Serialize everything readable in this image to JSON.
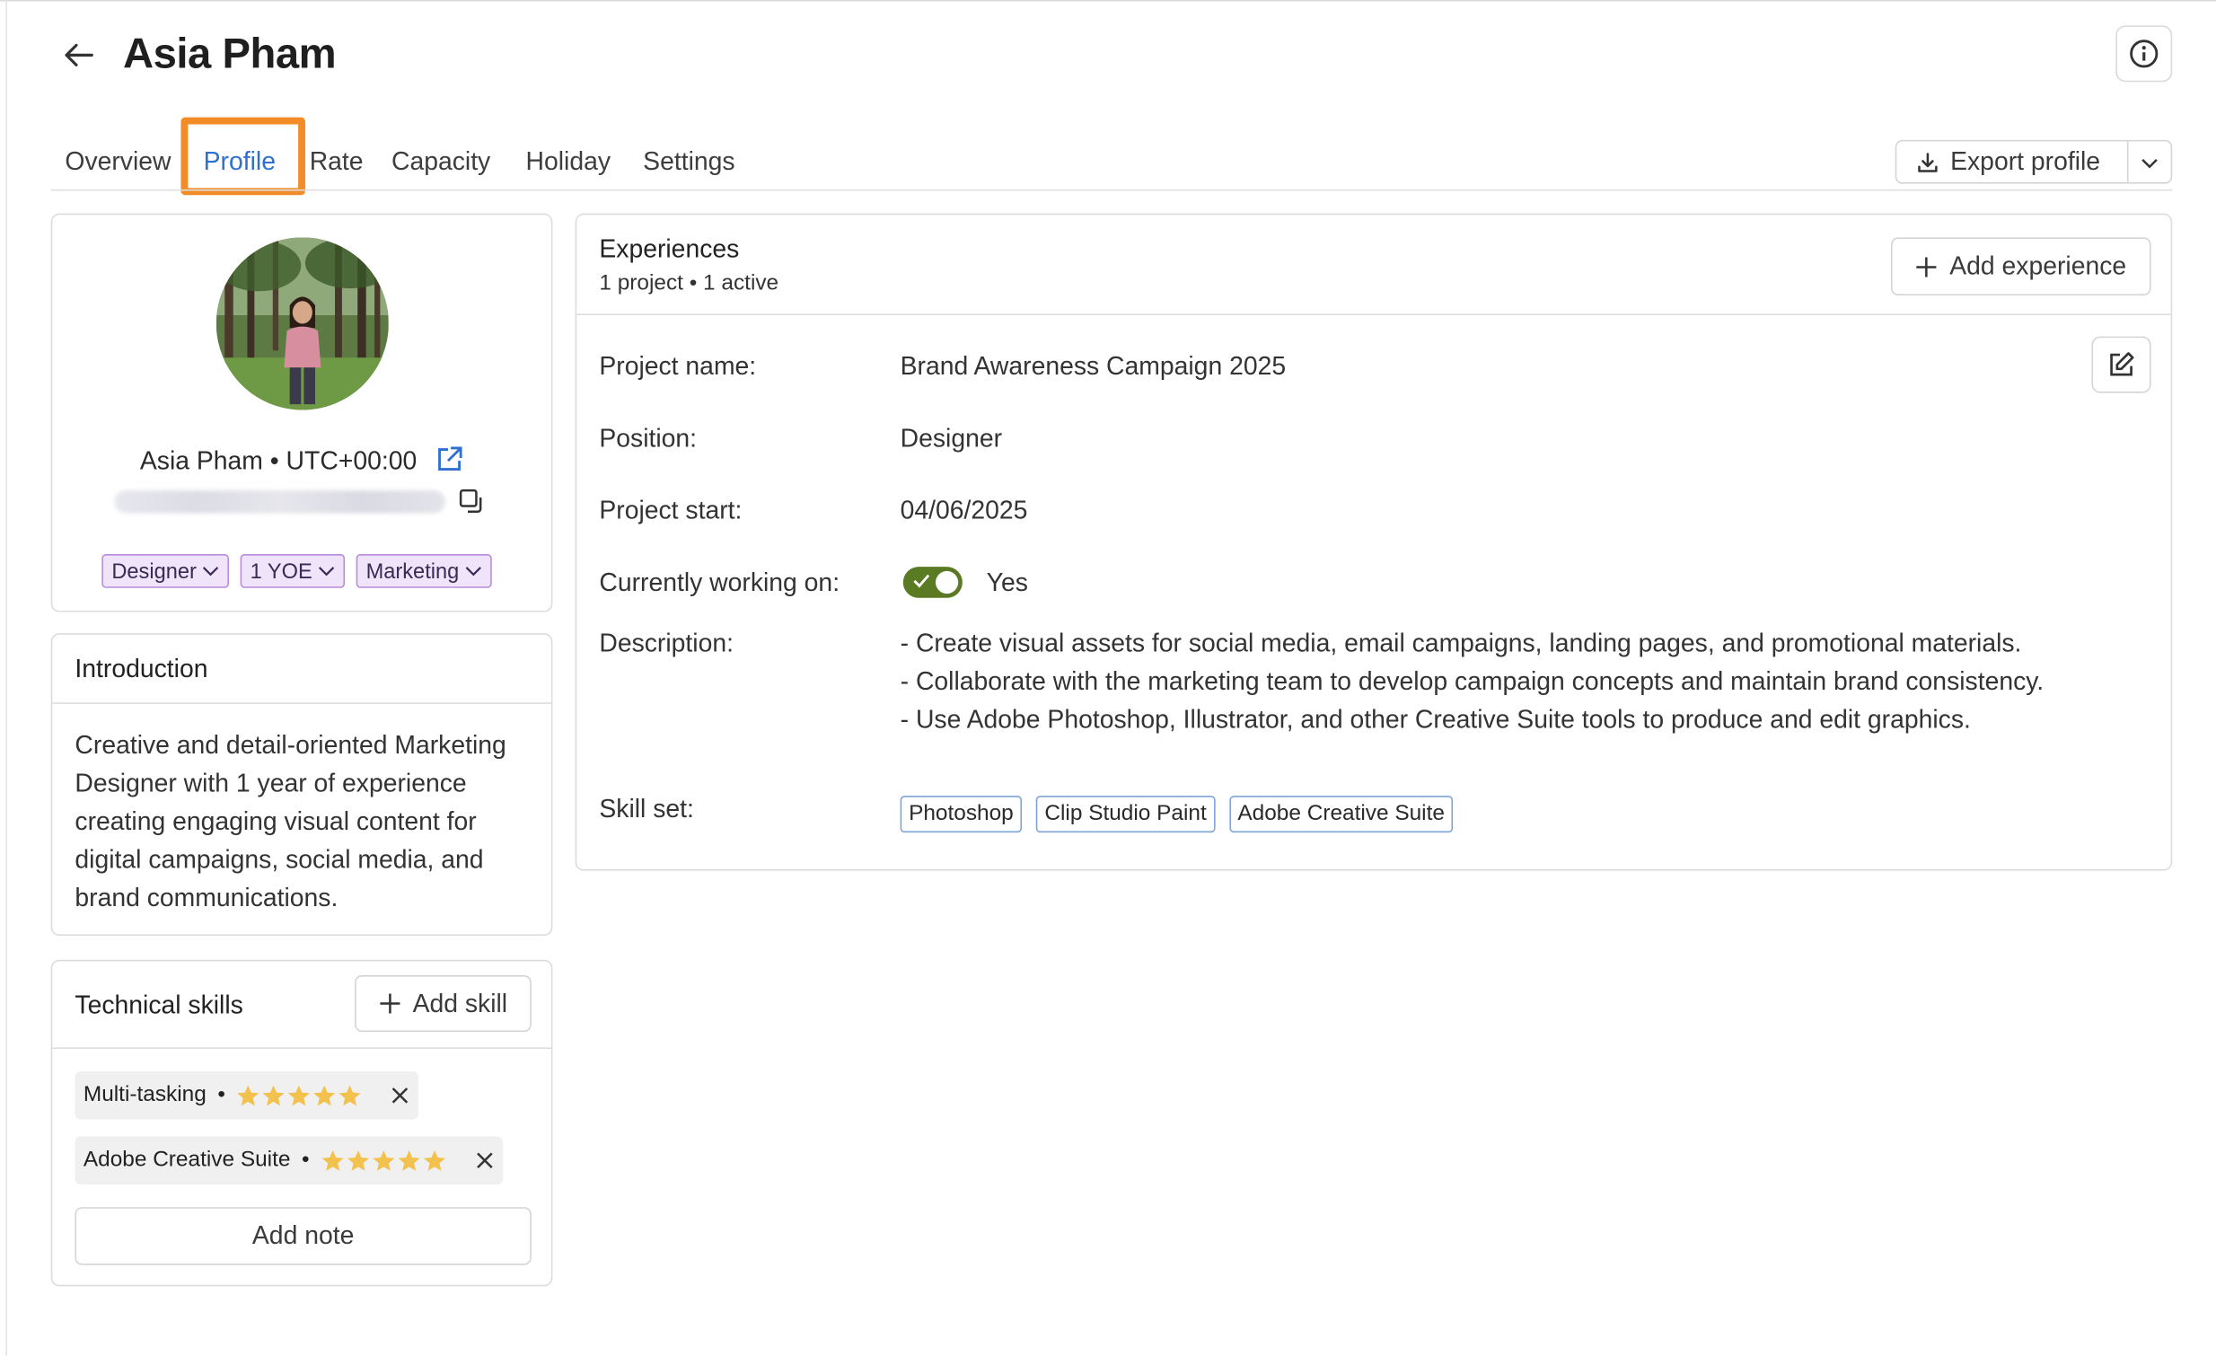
{
  "header": {
    "title": "Asia Pham"
  },
  "tabs": [
    {
      "label": "Overview"
    },
    {
      "label": "Profile"
    },
    {
      "label": "Rate"
    },
    {
      "label": "Capacity"
    },
    {
      "label": "Holiday"
    },
    {
      "label": "Settings"
    }
  ],
  "active_tab": "Profile",
  "export": {
    "label": "Export profile"
  },
  "profile": {
    "name_line": "Asia Pham • UTC+00:00",
    "pills": [
      {
        "label": "Designer"
      },
      {
        "label": "1 YOE"
      },
      {
        "label": "Marketing"
      }
    ]
  },
  "introduction": {
    "title": "Introduction",
    "text": "Creative and detail-oriented Marketing Designer with 1 year of experience creating engaging visual content for digital campaigns, social media, and brand communications."
  },
  "skills": {
    "title": "Technical skills",
    "add_label": "Add skill",
    "items": [
      {
        "name": "Multi-tasking",
        "rating": 5
      },
      {
        "name": "Adobe Creative Suite",
        "rating": 5
      }
    ],
    "add_note_label": "Add note"
  },
  "experiences": {
    "title": "Experiences",
    "subtitle": "1 project • 1 active",
    "add_label": "Add experience",
    "labels": {
      "project_name": "Project name:",
      "position": "Position:",
      "project_start": "Project start:",
      "currently_working": "Currently working on:",
      "description": "Description:",
      "skill_set": "Skill set:"
    },
    "values": {
      "project_name": "Brand Awareness Campaign 2025",
      "position": "Designer",
      "project_start": "04/06/2025",
      "currently_working": "Yes",
      "description": [
        "- Create visual assets for social media, email campaigns, landing pages, and promotional materials.",
        "- Collaborate with the marketing team to develop campaign concepts and maintain brand consistency.",
        "- Use Adobe Photoshop, Illustrator, and other Creative Suite tools to produce and edit graphics."
      ],
      "skill_set": [
        "Photoshop",
        "Clip Studio Paint",
        "Adobe Creative Suite"
      ]
    }
  },
  "colors": {
    "accent": "#2f6fd1",
    "highlight": "#f28c28",
    "pill_bg": "#efe4fa",
    "toggle_on": "#5a7a24",
    "star": "#f2c14e"
  },
  "icons": [
    "back-arrow-icon",
    "info-icon",
    "download-icon",
    "chevron-down-icon",
    "external-link-icon",
    "copy-icon",
    "plus-icon",
    "star-icon",
    "close-icon",
    "edit-icon",
    "check-icon"
  ]
}
